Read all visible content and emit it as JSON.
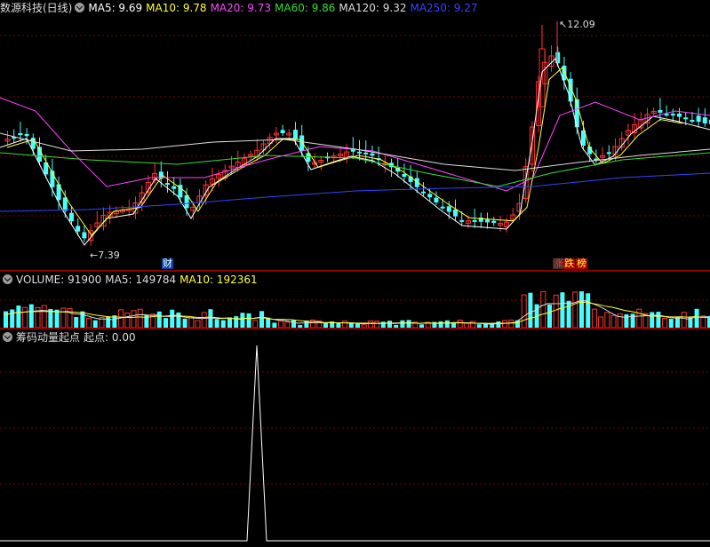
{
  "main_pane": {
    "stock_title": "数源科技(日线)",
    "indicators": [
      {
        "label": "MA5: 9.69",
        "color": "#ffffff"
      },
      {
        "label": "MA10: 9.78",
        "color": "#ffff33"
      },
      {
        "label": "MA20: 9.73",
        "color": "#ff44ff"
      },
      {
        "label": "MA60: 9.86",
        "color": "#33dd33"
      },
      {
        "label": "MA120: 9.32",
        "color": "#dddddd"
      },
      {
        "label": "MA250: 9.27",
        "color": "#3344ff"
      }
    ],
    "high_marker": "12.09",
    "low_marker": "7.39",
    "tags": [
      {
        "text": "财",
        "color": "#ffffff",
        "bg": "#0044aa"
      },
      {
        "text": "涨",
        "color": "#ff3333",
        "bg": "#333333"
      },
      {
        "text": "跌",
        "color": "#ffff33",
        "bg": "#aa0000"
      },
      {
        "text": "榜",
        "color": "#ffff33",
        "bg": "#aa0000"
      }
    ]
  },
  "volume_pane": {
    "indicators": [
      {
        "label": "VOLUME: 91900",
        "color": "#dddddd"
      },
      {
        "label": "MA5: 149784",
        "color": "#dddddd"
      },
      {
        "label": "MA10: 192361",
        "color": "#ffff33"
      }
    ]
  },
  "signal_pane": {
    "title": "筹码动量起点",
    "value_label": "起点: 0.00"
  },
  "colors": {
    "up": "#ff3333",
    "down": "#44ffff",
    "grid": "#7a0000",
    "background": "#000000"
  }
}
